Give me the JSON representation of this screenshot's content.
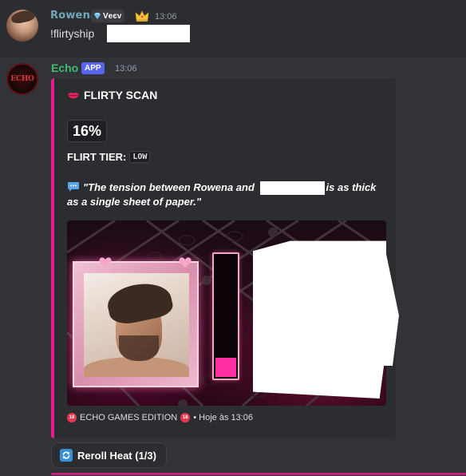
{
  "message1": {
    "username": "Rowena",
    "tag": "Vеєv",
    "icons": [
      "gem-icon",
      "crown-icon"
    ],
    "time": "13:06",
    "content": "!flirtyship"
  },
  "message2": {
    "username": "Echo",
    "badge": "APP",
    "time": "13:06",
    "avatar_text": "ECHO"
  },
  "embed": {
    "accent_color": "#e91e8c",
    "title": "FLIRTY SCAN",
    "title_icon": "lips-icon",
    "percent": "16%",
    "tier_label": "FLIRT TIER:",
    "tier_value": "LOW",
    "quote_line1_a": "\"The tension between Rowena and",
    "quote_line1_b": "is as thick",
    "quote_line2": "as a single sheet of paper.\"",
    "gauge_level": 0.16,
    "footer_badge": "18",
    "footer_text": "ECHO GAMES EDITION",
    "footer_time": "• Hoje às 13:06"
  },
  "button": {
    "label": "Reroll Heat (1/3)",
    "icon": "refresh-icon"
  }
}
